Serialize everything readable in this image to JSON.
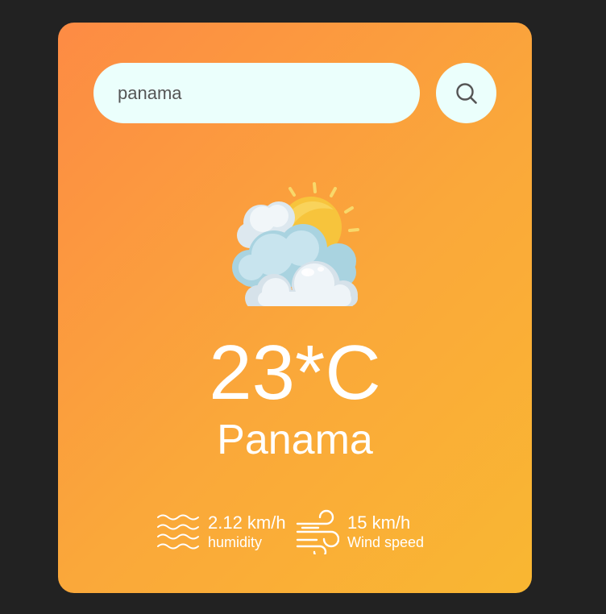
{
  "search": {
    "value": "panama",
    "placeholder": "",
    "button_icon": "search-icon"
  },
  "weather": {
    "icon": "partly-cloudy-sun-icon",
    "temperature": "23*C",
    "city": "Panama"
  },
  "details": {
    "humidity": {
      "icon": "humidity-waves-icon",
      "value": "2.12 km/h",
      "label": "humidity"
    },
    "wind": {
      "icon": "wind-icon",
      "value": "15 km/h",
      "label": "Wind speed"
    }
  },
  "colors": {
    "background": "#222222",
    "card_gradient_start": "#fd8b44",
    "card_gradient_end": "#f9b732",
    "input_background": "#ebfffc",
    "text": "#ffffff"
  }
}
